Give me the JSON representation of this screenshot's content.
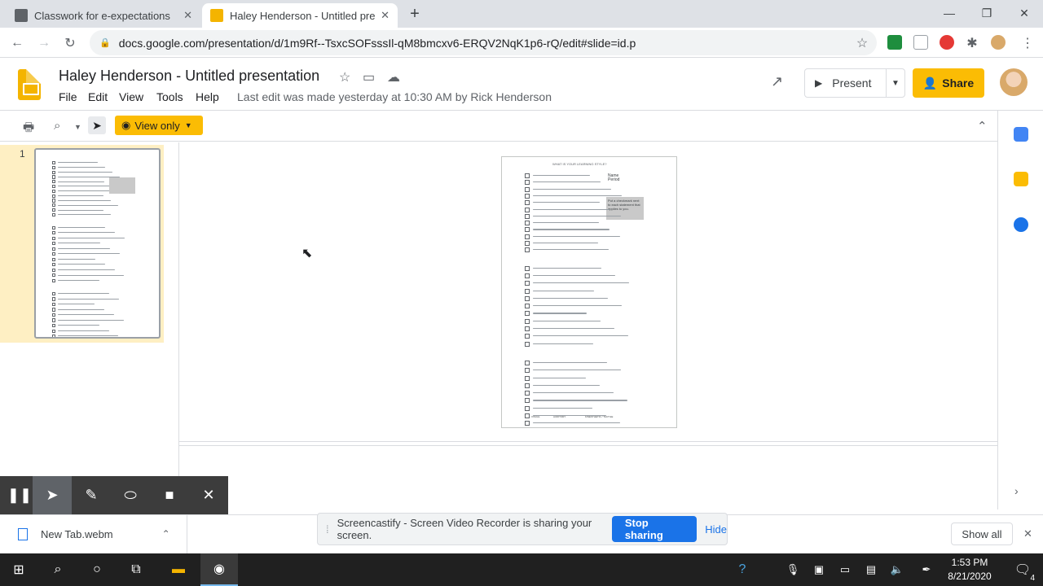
{
  "browser": {
    "tabs": [
      {
        "title": "Classwork for e-expectations",
        "active": false
      },
      {
        "title": "Haley Henderson - Untitled prese",
        "active": true
      }
    ],
    "url": "docs.google.com/presentation/d/1m9Rf--TsxcSOFsssIl-qM8bmcxv6-ERQV2NqK1p6-rQ/edit#slide=id.p"
  },
  "slides": {
    "doc_title": "Haley Henderson - Untitled presentation",
    "menu": [
      "File",
      "Edit",
      "View",
      "Tools",
      "Help"
    ],
    "last_edit": "Last edit was made yesterday at 10:30 AM by Rick Henderson",
    "present_label": "Present",
    "share_label": "Share",
    "view_only_label": "View only",
    "slide_number": "1",
    "slide_content": {
      "heading": "WHAT IS YOUR LEARNING STYLE?",
      "name_label": "Name",
      "period_label": "Period",
      "note": "Put a checkmark next to each statement that applies to you.",
      "footer_options": [
        "VISUAL",
        "AUDITORY",
        "KINESTHETIC / TACTILE"
      ]
    }
  },
  "screencastify": {
    "banner_text": "Screencastify - Screen Video Recorder is sharing your screen.",
    "stop_label": "Stop sharing",
    "hide_label": "Hide"
  },
  "downloads": {
    "file": "New Tab.webm",
    "show_all": "Show all"
  },
  "taskbar": {
    "time": "1:53 PM",
    "date": "8/21/2020",
    "notification_count": "4"
  },
  "colors": {
    "accent_yellow": "#fbbc04",
    "blue": "#1a73e8",
    "thumb_highlight": "#feefc3"
  }
}
